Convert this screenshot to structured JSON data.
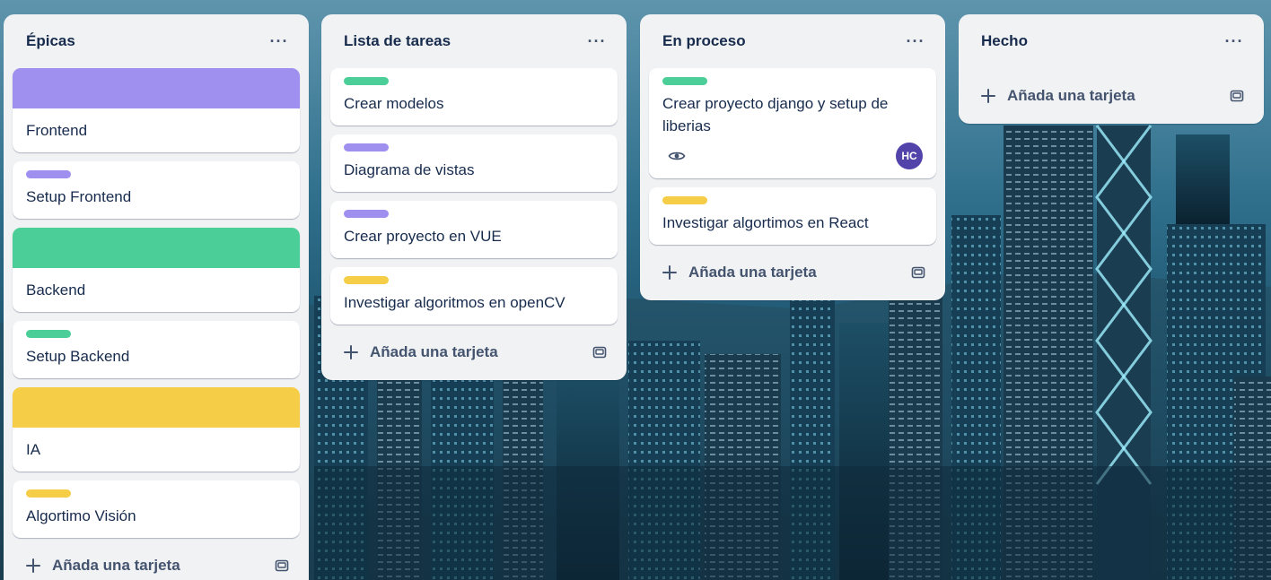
{
  "colors": {
    "purple": "#9f8fef",
    "green": "#4bce97",
    "yellow": "#f5cd47",
    "list_bg": "#f1f2f4",
    "avatar": "#5243aa"
  },
  "lists": [
    {
      "title": "Épicas",
      "menu": "···",
      "add_label": "Añada una tarjeta",
      "cards": [
        {
          "title": "Frontend",
          "cover": "purple"
        },
        {
          "title": "Setup Frontend",
          "label": "purple"
        },
        {
          "title": "Backend",
          "cover": "green"
        },
        {
          "title": "Setup Backend",
          "label": "green"
        },
        {
          "title": "IA",
          "cover": "yellow"
        },
        {
          "title": "Algortimo Visión",
          "label": "yellow"
        }
      ]
    },
    {
      "title": "Lista de tareas",
      "menu": "···",
      "add_label": "Añada una tarjeta",
      "cards": [
        {
          "title": "Crear modelos",
          "label": "green"
        },
        {
          "title": "Diagrama de vistas",
          "label": "purple"
        },
        {
          "title": "Crear proyecto en VUE",
          "label": "purple"
        },
        {
          "title": "Investigar algoritmos en openCV",
          "label": "yellow"
        }
      ]
    },
    {
      "title": "En proceso",
      "menu": "···",
      "add_label": "Añada una tarjeta",
      "cards": [
        {
          "title": "Crear proyecto django y setup de liberias",
          "label": "green",
          "watch_icon": "eye-icon",
          "member": "HC"
        },
        {
          "title": "Investigar algortimos en React",
          "label": "yellow"
        }
      ]
    },
    {
      "title": "Hecho",
      "menu": "···",
      "add_label": "Añada una tarjeta",
      "cards": []
    }
  ]
}
